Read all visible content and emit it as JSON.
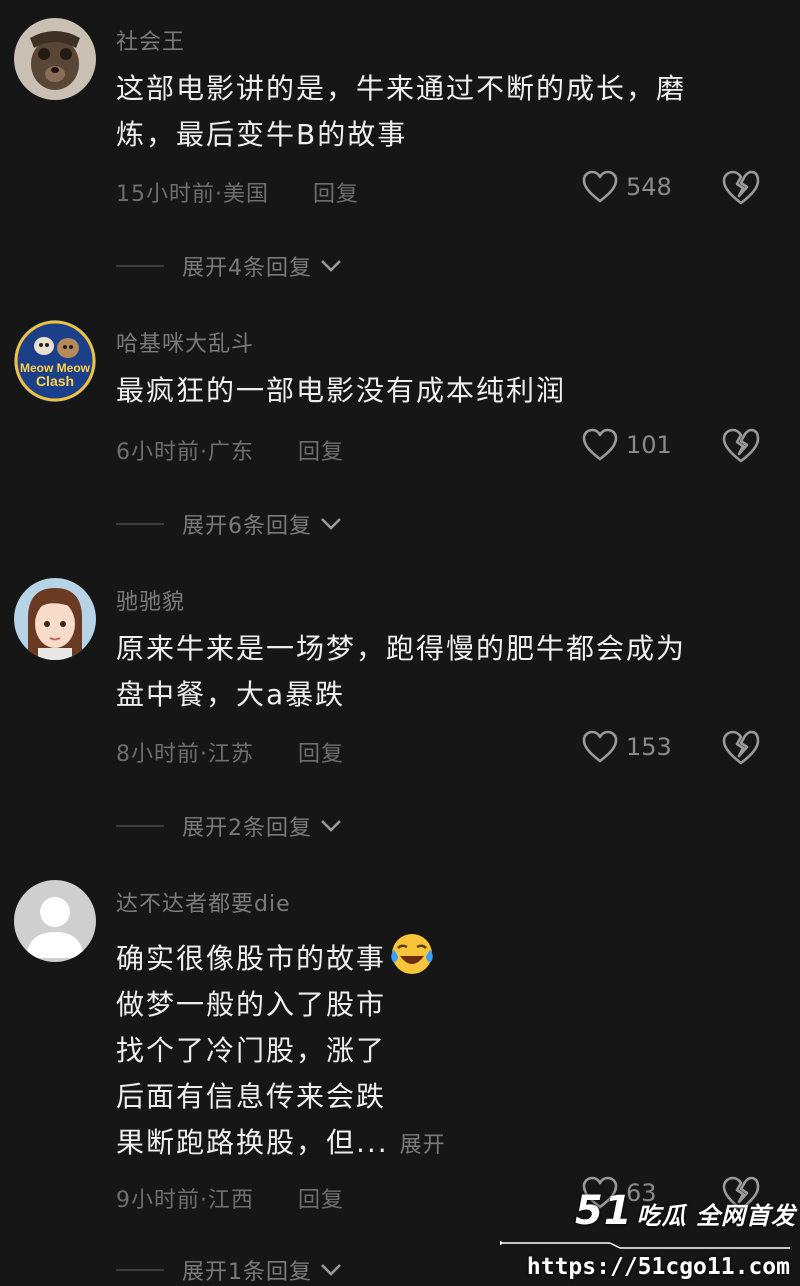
{
  "comments": [
    {
      "username": "社会王",
      "lines": [
        "这部电影讲的是，牛来通过不断的成长，磨",
        "炼，最后变牛B的故事"
      ],
      "time_location": "15小时前·美国",
      "reply_label": "回复",
      "likes": "548",
      "expand_label": "展开4条回复"
    },
    {
      "username": "哈基咪大乱斗",
      "lines": [
        "最疯狂的一部电影没有成本纯利润"
      ],
      "time_location": "6小时前·广东",
      "reply_label": "回复",
      "likes": "101",
      "expand_label": "展开6条回复",
      "avatar_text": [
        "Meow Meow",
        "Clash"
      ]
    },
    {
      "username": "驰驰貌",
      "lines": [
        "原来牛来是一场梦，跑得慢的肥牛都会成为",
        "盘中餐，大a暴跌"
      ],
      "time_location": "8小时前·江苏",
      "reply_label": "回复",
      "likes": "153",
      "expand_label": "展开2条回复"
    },
    {
      "username": "达不达者都要die",
      "lines": [
        "确实很像股市的故事",
        "做梦一般的入了股市",
        "找个了冷门股，涨了",
        "后面有信息传来会跌",
        "果断跑路换股，但..."
      ],
      "inline_expand": "展开",
      "time_location": "9小时前·江西",
      "reply_label": "回复",
      "likes": "63",
      "expand_label": "展开1条回复"
    }
  ],
  "watermark": {
    "brand_number": "51",
    "brand_text": "吃瓜 全网首发",
    "url": "https://51cgo11.com"
  },
  "colors": {
    "background": "#161616",
    "text": "#eeeeee",
    "muted": "#7a7a7a"
  }
}
